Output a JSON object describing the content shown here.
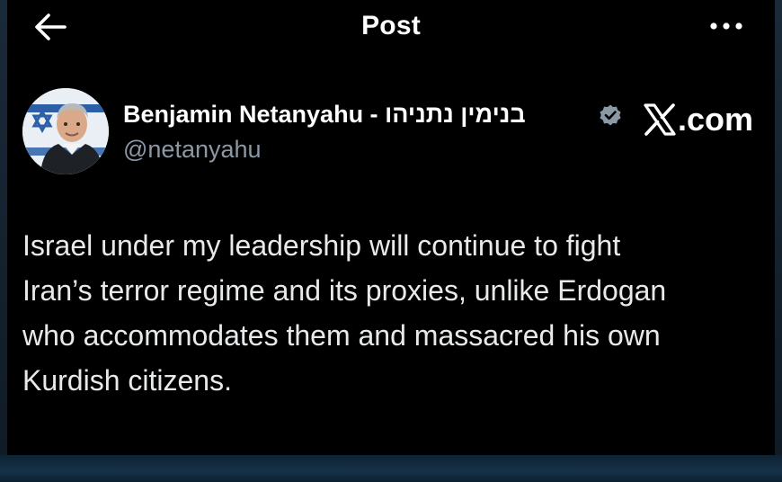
{
  "header": {
    "title": "Post",
    "back_icon": "arrow-left-icon",
    "more_icon": "more-horizontal-icon"
  },
  "author": {
    "display_name": "Benjamin Netanyahu - בנימין נתניהו",
    "handle": "@netanyahu",
    "verified": true,
    "verified_color": "#8b98a5"
  },
  "watermark": {
    "text": ".com",
    "logo_icon": "x-logo-icon"
  },
  "post": {
    "lines": [
      "Israel under my leadership will continue to fight",
      "Iran’s terror regime and its proxies, unlike Erdogan",
      "who accommodates them and massacred his own",
      "Kurdish citizens."
    ]
  },
  "colors": {
    "background": "#000000",
    "text": "#e7e9ea",
    "secondary_text": "#8b98a5"
  }
}
